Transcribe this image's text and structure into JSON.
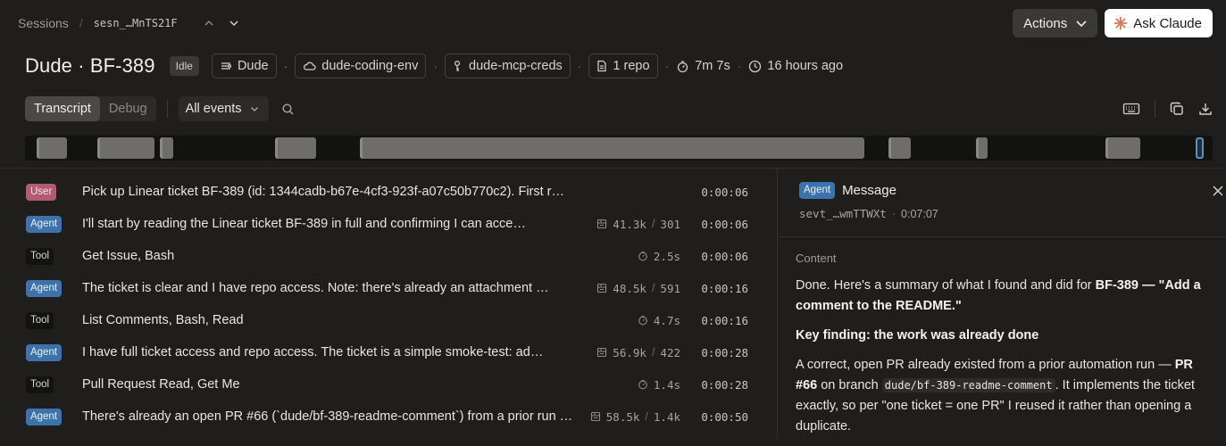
{
  "breadcrumb": {
    "sessions": "Sessions",
    "session_id": "sesn_…MnTS21F"
  },
  "actions": {
    "actions_label": "Actions",
    "ask_label": "Ask Claude"
  },
  "header": {
    "title": "Dude · BF-389",
    "status": "Idle",
    "agent": "Dude",
    "environment": "dude-coding-env",
    "credentials": "dude-mcp-creds",
    "repos": "1 repo",
    "duration": "7m 7s",
    "age": "16 hours ago"
  },
  "toolbar": {
    "tab_transcript": "Transcript",
    "tab_debug": "Debug",
    "filter": "All events"
  },
  "events": [
    {
      "role": "User",
      "text": "Pick up Linear ticket BF-389 (id: 1344cadb-b67e-4cf3-923f-a07c50b770c2). First r…",
      "tokens_in": "",
      "tokens_out": "",
      "duration": "",
      "time": "0:00:06"
    },
    {
      "role": "Agent",
      "text": "I'll start by reading the Linear ticket BF-389 in full and confirming I can acce…",
      "tokens_in": "41.3k",
      "tokens_out": "301",
      "duration": "",
      "time": "0:00:06"
    },
    {
      "role": "Tool",
      "text": "Get Issue, Bash",
      "tokens_in": "",
      "tokens_out": "",
      "duration": "2.5s",
      "time": "0:00:06"
    },
    {
      "role": "Agent",
      "text": "The ticket is clear and I have repo access. Note: there's already an attachment …",
      "tokens_in": "48.5k",
      "tokens_out": "591",
      "duration": "",
      "time": "0:00:16"
    },
    {
      "role": "Tool",
      "text": "List Comments, Bash, Read",
      "tokens_in": "",
      "tokens_out": "",
      "duration": "4.7s",
      "time": "0:00:16"
    },
    {
      "role": "Agent",
      "text": "I have full ticket access and repo access. The ticket is a simple smoke-test: ad…",
      "tokens_in": "56.9k",
      "tokens_out": "422",
      "duration": "",
      "time": "0:00:28"
    },
    {
      "role": "Tool",
      "text": "Pull Request Read, Get Me",
      "tokens_in": "",
      "tokens_out": "",
      "duration": "1.4s",
      "time": "0:00:28"
    },
    {
      "role": "Agent",
      "text": "There's already an open PR #66 (`dude/bf-389-readme-comment`) from a prior run …",
      "tokens_in": "58.5k",
      "tokens_out": "1.4k",
      "duration": "",
      "time": "0:00:50"
    }
  ],
  "detail": {
    "role": "Agent",
    "title": "Message",
    "event_id": "sevt_…wmTTWXt",
    "time": "0:07:07",
    "content_label": "Content",
    "p1_a": "Done. Here's a summary of what I found and did for ",
    "p1_b": "BF-389 — \"Add a comment to the README.\"",
    "h1": "Key finding: the work was already done",
    "p2_a": "A correct, open PR already existed from a prior automation run — ",
    "p2_b": "PR #66",
    "p2_c": " on branch ",
    "p2_code": "dude/bf-389-readme-comment",
    "p2_d": ". It implements the ticket exactly, so per \"one ticket = one PR\" I reused it rather than opening a duplicate."
  },
  "timeline": {
    "duration_seconds": 427,
    "segments": [
      {
        "start": 1,
        "end": 12
      },
      {
        "start": 23,
        "end": 44
      },
      {
        "start": 46,
        "end": 51
      },
      {
        "start": 88,
        "end": 103
      },
      {
        "start": 119,
        "end": 303
      },
      {
        "start": 312,
        "end": 320
      },
      {
        "start": 344,
        "end": 348
      },
      {
        "start": 391,
        "end": 404
      },
      {
        "start": 424,
        "end": 427,
        "selected": true
      }
    ]
  },
  "colors": {
    "background": "#1f1e1d",
    "user_tag": "#b45b74",
    "agent_tag": "#3d73ad",
    "tool_tag": "#131312",
    "claude_spark": "#d97757"
  }
}
